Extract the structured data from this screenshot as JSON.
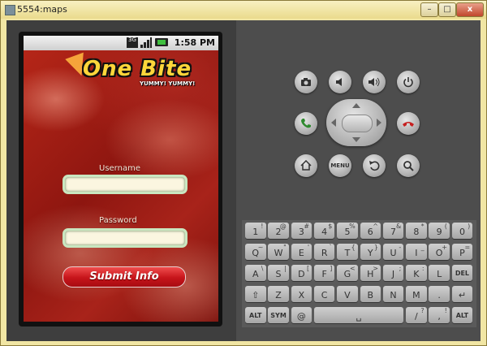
{
  "window": {
    "title": "5554:maps",
    "minimize_label": "–",
    "maximize_label": "□",
    "close_label": "x"
  },
  "statusbar": {
    "network_label": "3G",
    "time": "1:58 PM"
  },
  "app": {
    "logo_text": "One Bite",
    "logo_subtitle": "YUMMY! YUMMY!",
    "username_label": "Username",
    "username_value": "",
    "password_label": "Password",
    "password_value": "",
    "submit_label": "Submit Info"
  },
  "controls": {
    "menu_label": "MENU"
  },
  "keyboard": {
    "rows": [
      [
        {
          "k": "1",
          "s": "!"
        },
        {
          "k": "2",
          "s": "@"
        },
        {
          "k": "3",
          "s": "#"
        },
        {
          "k": "4",
          "s": "$"
        },
        {
          "k": "5",
          "s": "%"
        },
        {
          "k": "6",
          "s": "^"
        },
        {
          "k": "7",
          "s": "&"
        },
        {
          "k": "8",
          "s": "*"
        },
        {
          "k": "9",
          "s": "("
        },
        {
          "k": "0",
          "s": ")"
        }
      ],
      [
        {
          "k": "Q",
          "s": "~"
        },
        {
          "k": "W",
          "s": "\""
        },
        {
          "k": "E",
          "s": "'"
        },
        {
          "k": "R",
          "s": "`"
        },
        {
          "k": "T",
          "s": "{"
        },
        {
          "k": "Y",
          "s": "}"
        },
        {
          "k": "U",
          "s": "-"
        },
        {
          "k": "I",
          "s": "_"
        },
        {
          "k": "O",
          "s": "+"
        },
        {
          "k": "P",
          "s": "="
        }
      ],
      [
        {
          "k": "A",
          "s": "\\"
        },
        {
          "k": "S",
          "s": "|"
        },
        {
          "k": "D",
          "s": "["
        },
        {
          "k": "F",
          "s": "]"
        },
        {
          "k": "G",
          "s": "<"
        },
        {
          "k": "H",
          "s": ">"
        },
        {
          "k": "J",
          "s": ";"
        },
        {
          "k": "K",
          "s": ":"
        },
        {
          "k": "L",
          "s": ""
        },
        {
          "k": "DEL",
          "s": ""
        }
      ],
      [
        {
          "k": "⇧",
          "s": ""
        },
        {
          "k": "Z",
          "s": ""
        },
        {
          "k": "X",
          "s": ""
        },
        {
          "k": "C",
          "s": ""
        },
        {
          "k": "V",
          "s": ""
        },
        {
          "k": "B",
          "s": ""
        },
        {
          "k": "N",
          "s": ""
        },
        {
          "k": "M",
          "s": ""
        },
        {
          "k": ".",
          "s": ""
        },
        {
          "k": "↵",
          "s": ""
        }
      ],
      [
        {
          "k": "ALT",
          "s": ""
        },
        {
          "k": "SYM",
          "s": ""
        },
        {
          "k": "@",
          "s": ""
        },
        {
          "k": "␣",
          "s": ""
        },
        {
          "k": "/",
          "s": "?"
        },
        {
          "k": ",",
          "s": "!"
        },
        {
          "k": "ALT",
          "s": ""
        }
      ]
    ]
  }
}
